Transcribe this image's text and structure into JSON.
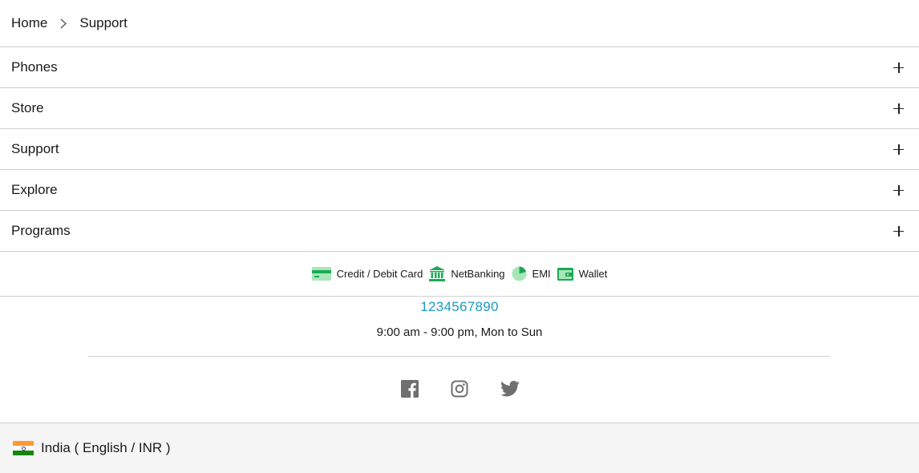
{
  "breadcrumb": {
    "home": "Home",
    "current": "Support"
  },
  "accordion": [
    {
      "label": "Phones"
    },
    {
      "label": "Store"
    },
    {
      "label": "Support"
    },
    {
      "label": "Explore"
    },
    {
      "label": "Programs"
    }
  ],
  "payments": [
    {
      "label": "Credit / Debit Card",
      "icon": "credit-card-icon"
    },
    {
      "label": "NetBanking",
      "icon": "bank-icon"
    },
    {
      "label": "EMI",
      "icon": "pie-chart-icon"
    },
    {
      "label": "Wallet",
      "icon": "wallet-icon"
    }
  ],
  "contact": {
    "phone": "1234567890",
    "hours": "9:00 am - 9:00 pm, Mon to Sun"
  },
  "social": [
    "facebook-icon",
    "instagram-icon",
    "twitter-icon"
  ],
  "locale": {
    "label": "India ( English / INR )"
  },
  "colors": {
    "accent_green": "#1aaa55",
    "phone_blue": "#1a9ac2",
    "icon_gray": "#6f6f6f"
  }
}
